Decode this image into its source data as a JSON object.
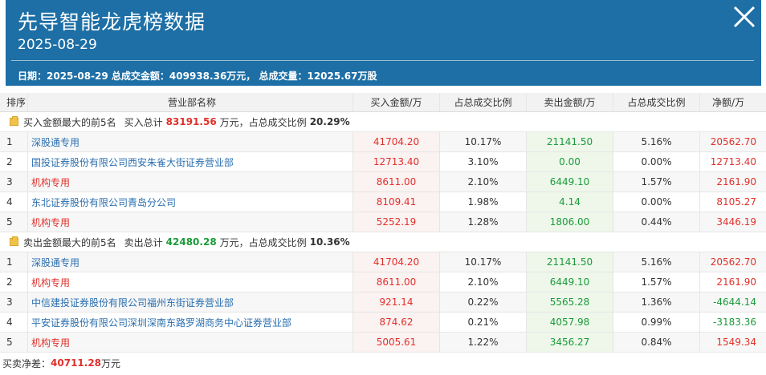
{
  "header": {
    "title": "先导智能龙虎榜数据",
    "date": "2025-08-29",
    "summary": "日期：2025-08-29 总成交金额：409938.36万元， 总成交量：12025.67万股"
  },
  "columns": [
    "排序",
    "营业部名称",
    "买入金额/万",
    "占总成交比例",
    "卖出金额/万",
    "占总成交比例",
    "净额/万"
  ],
  "buy_section": {
    "label": "买入金额最大的前5名",
    "total_label": "买入总计",
    "total_value": "83191.56",
    "unit": "万元，占总成交比例",
    "ratio": "20.29%"
  },
  "buy_rows": [
    {
      "rank": "1",
      "name": "深股通专用",
      "buy": "41704.20",
      "buy_ratio": "10.17%",
      "sell": "21141.50",
      "sell_ratio": "5.16%",
      "net": "20562.70",
      "name_color": "blue"
    },
    {
      "rank": "2",
      "name": "国投证券股份有限公司西安朱雀大街证券营业部",
      "buy": "12713.40",
      "buy_ratio": "3.10%",
      "sell": "0.00",
      "sell_ratio": "0.00%",
      "net": "12713.40",
      "name_color": "blue"
    },
    {
      "rank": "3",
      "name": "机构专用",
      "buy": "8611.00",
      "buy_ratio": "2.10%",
      "sell": "6449.10",
      "sell_ratio": "1.57%",
      "net": "2161.90",
      "name_color": "red"
    },
    {
      "rank": "4",
      "name": "东北证券股份有限公司青岛分公司",
      "buy": "8109.41",
      "buy_ratio": "1.98%",
      "sell": "4.14",
      "sell_ratio": "0.00%",
      "net": "8105.27",
      "name_color": "blue"
    },
    {
      "rank": "5",
      "name": "机构专用",
      "buy": "5252.19",
      "buy_ratio": "1.28%",
      "sell": "1806.00",
      "sell_ratio": "0.44%",
      "net": "3446.19",
      "name_color": "red"
    }
  ],
  "sell_section": {
    "label": "卖出金额最大的前5名",
    "total_label": "卖出总计",
    "total_value": "42480.28",
    "unit": "万元，占总成交比例",
    "ratio": "10.36%"
  },
  "sell_rows": [
    {
      "rank": "1",
      "name": "深股通专用",
      "buy": "41704.20",
      "buy_ratio": "10.17%",
      "sell": "21141.50",
      "sell_ratio": "5.16%",
      "net": "20562.70",
      "name_color": "blue"
    },
    {
      "rank": "2",
      "name": "机构专用",
      "buy": "8611.00",
      "buy_ratio": "2.10%",
      "sell": "6449.10",
      "sell_ratio": "1.57%",
      "net": "2161.90",
      "name_color": "red"
    },
    {
      "rank": "3",
      "name": "中信建投证券股份有限公司福州东街证券营业部",
      "buy": "921.14",
      "buy_ratio": "0.22%",
      "sell": "5565.28",
      "sell_ratio": "1.36%",
      "net": "-4644.14",
      "name_color": "blue"
    },
    {
      "rank": "4",
      "name": "平安证券股份有限公司深圳深南东路罗湖商务中心证券营业部",
      "buy": "874.62",
      "buy_ratio": "0.21%",
      "sell": "4057.98",
      "sell_ratio": "0.99%",
      "net": "-3183.36",
      "name_color": "blue"
    },
    {
      "rank": "5",
      "name": "机构专用",
      "buy": "5005.61",
      "buy_ratio": "1.22%",
      "sell": "3456.27",
      "sell_ratio": "0.84%",
      "net": "1549.34",
      "name_color": "red"
    }
  ],
  "footer": {
    "label": "买卖净差：",
    "value": "40711.28",
    "unit": "万元"
  },
  "icons": {
    "close": "close-icon",
    "section": "wallet-icon"
  },
  "colors": {
    "header_bg": "#1d6fa6",
    "buy_red": "#e0302a",
    "sell_green": "#1a9a3a",
    "seat_blue": "#2a6fb0"
  }
}
